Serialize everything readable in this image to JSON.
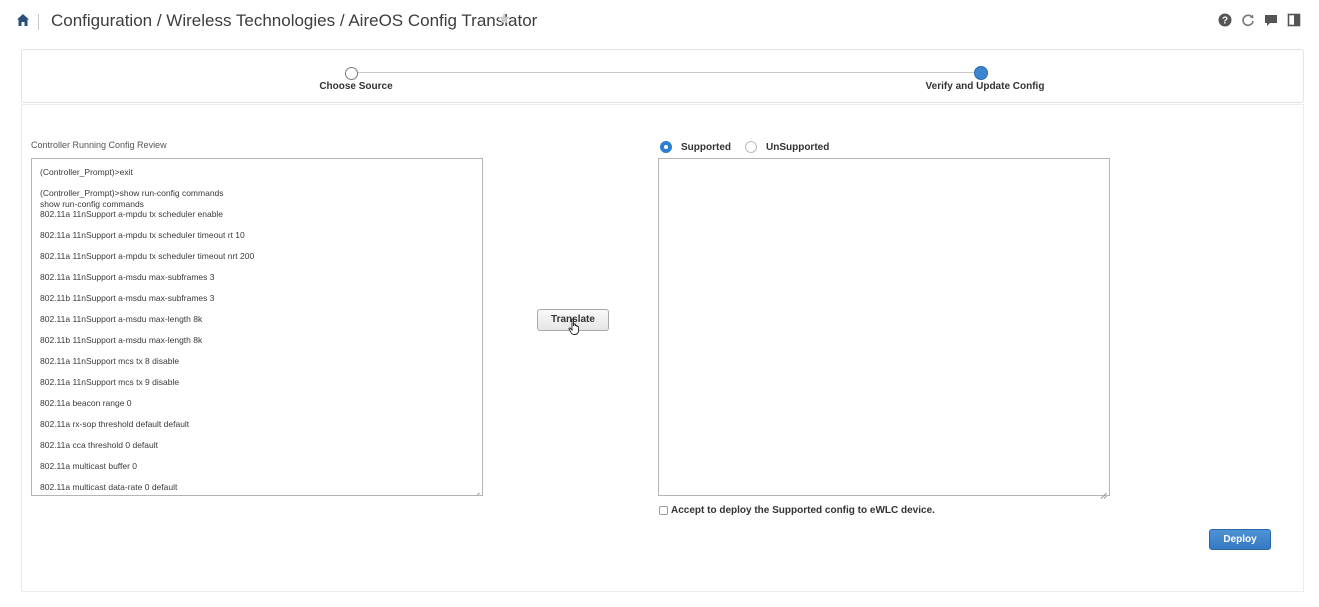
{
  "header": {
    "breadcrumb": "Configuration / Wireless Technologies / AireOS Config Translator",
    "icons": [
      "home-icon",
      "star-icon",
      "help-icon",
      "refresh-icon",
      "chat-icon",
      "panel-icon"
    ]
  },
  "stepper": {
    "steps": [
      {
        "label": "Choose Source",
        "state": "completed"
      },
      {
        "label": "Verify and Update Config",
        "state": "active"
      }
    ]
  },
  "left_panel": {
    "title": "Controller Running Config Review",
    "lines": [
      "(Controller_Prompt)>exit",
      "(Controller_Prompt)>show run-config commands",
      "show run-config commands",
      "802.11a 11nSupport a-mpdu tx scheduler enable",
      "802.11a 11nSupport a-mpdu tx scheduler timeout rt 10",
      "802.11a 11nSupport a-mpdu tx scheduler timeout nrt 200",
      "802.11a 11nSupport a-msdu max-subframes 3",
      "802.11b 11nSupport a-msdu max-subframes 3",
      "802.11a 11nSupport a-msdu max-length 8k",
      "802.11b 11nSupport a-msdu max-length 8k",
      "802.11a 11nSupport mcs tx 8 disable",
      "802.11a 11nSupport mcs tx 9 disable",
      "802.11a beacon range 0",
      "802.11a rx-sop threshold default default",
      "802.11a cca threshold 0 default",
      "802.11a multicast buffer 0",
      "802.11a multicast data-rate 0 default"
    ]
  },
  "translate_label": "Translate",
  "right_panel": {
    "supported_label": "Supported",
    "unsupported_label": "UnSupported",
    "selected": "Supported",
    "output": "",
    "accept_label": "Accept to deploy the Supported config to eWLC device.",
    "accept_checked": false
  },
  "deploy_label": "Deploy",
  "colors": {
    "accent": "#2d7fd1",
    "deploy": "#3479c2"
  }
}
